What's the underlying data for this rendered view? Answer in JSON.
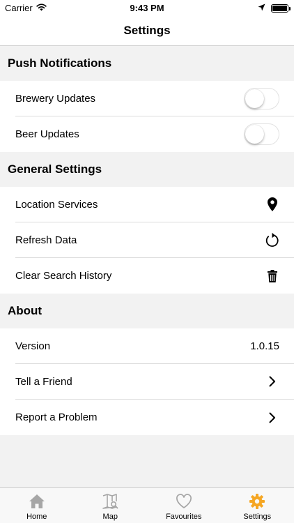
{
  "status_bar": {
    "carrier": "Carrier",
    "time": "9:43 PM"
  },
  "nav": {
    "title": "Settings"
  },
  "sections": {
    "push": {
      "header": "Push Notifications",
      "brewery_updates": {
        "label": "Brewery Updates",
        "on": false
      },
      "beer_updates": {
        "label": "Beer Updates",
        "on": false
      }
    },
    "general": {
      "header": "General Settings",
      "location": {
        "label": "Location Services",
        "icon": "location-pin-icon"
      },
      "refresh": {
        "label": "Refresh Data",
        "icon": "refresh-icon"
      },
      "clear_history": {
        "label": "Clear Search History",
        "icon": "trash-icon"
      }
    },
    "about": {
      "header": "About",
      "version": {
        "label": "Version",
        "value": "1.0.15"
      },
      "tell_friend": {
        "label": "Tell a Friend",
        "icon": "chevron-right-icon"
      },
      "report": {
        "label": "Report a Problem",
        "icon": "chevron-right-icon"
      }
    }
  },
  "tab_bar": {
    "home": "Home",
    "map": "Map",
    "favourites": "Favourites",
    "settings": "Settings",
    "inactive_color": "#a6a6a6",
    "active_color": "#f5a623"
  }
}
